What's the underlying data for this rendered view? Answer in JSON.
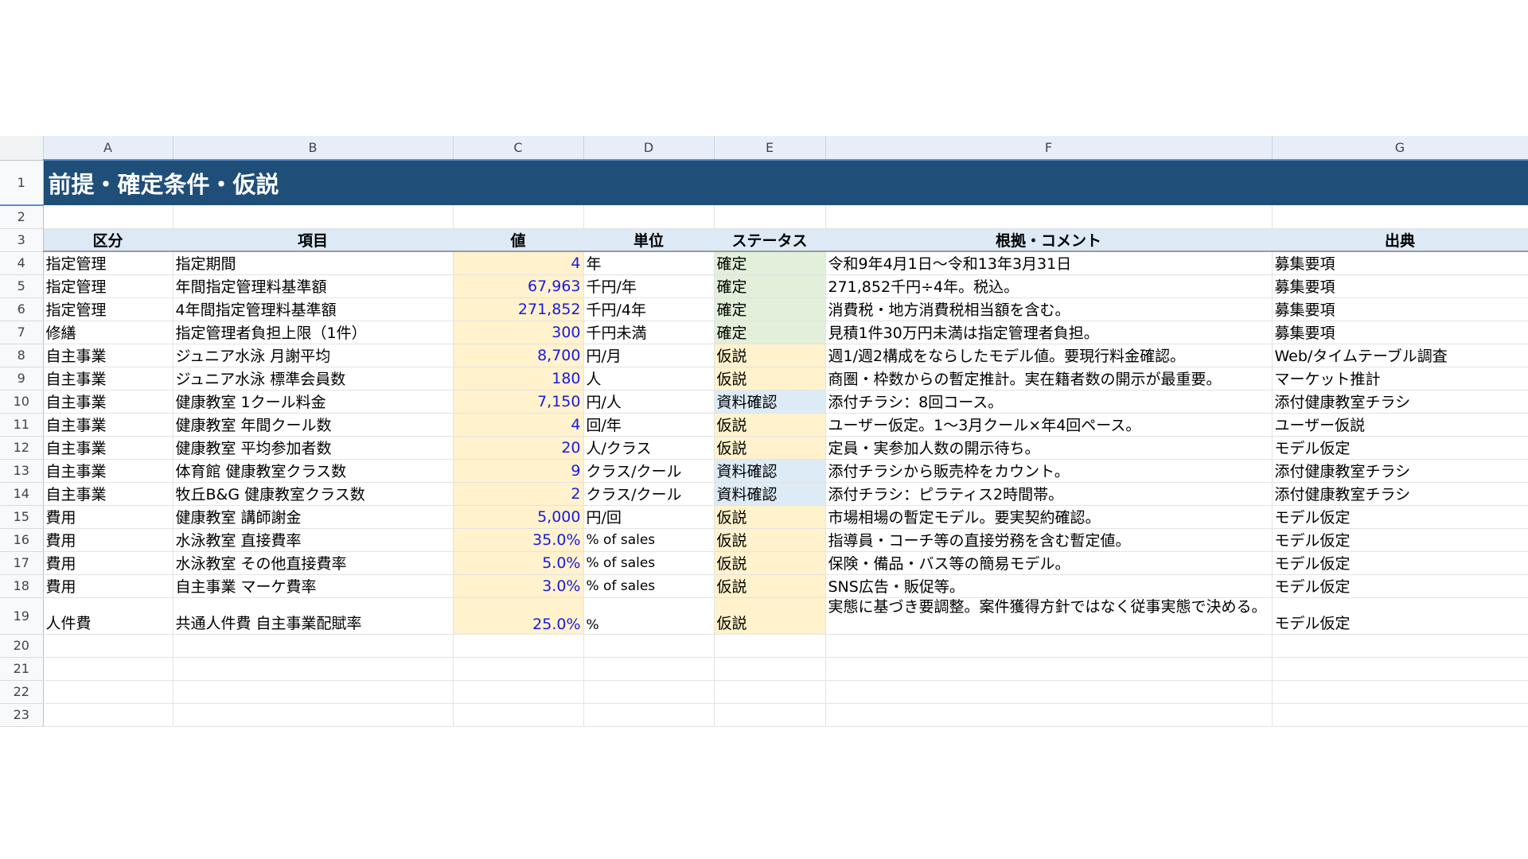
{
  "columns": [
    "A",
    "B",
    "C",
    "D",
    "E",
    "F",
    "G"
  ],
  "title": "前提・確定条件・仮説",
  "headers": [
    "区分",
    "項目",
    "値",
    "単位",
    "ステータス",
    "根拠・コメント",
    "出典"
  ],
  "rows": [
    {
      "num": "4",
      "category": "指定管理",
      "item": "指定期間",
      "value": "4",
      "unit": "年",
      "status": "確定",
      "comment": "令和9年4月1日～令和13年3月31日",
      "source": "募集要項"
    },
    {
      "num": "5",
      "category": "指定管理",
      "item": "年間指定管理料基準額",
      "value": "67,963",
      "unit": "千円/年",
      "status": "確定",
      "comment": "271,852千円÷4年。税込。",
      "source": "募集要項"
    },
    {
      "num": "6",
      "category": "指定管理",
      "item": "4年間指定管理料基準額",
      "value": "271,852",
      "unit": "千円/4年",
      "status": "確定",
      "comment": "消費税・地方消費税相当額を含む。",
      "source": "募集要項"
    },
    {
      "num": "7",
      "category": "修繕",
      "item": "指定管理者負担上限（1件）",
      "value": "300",
      "unit": "千円未満",
      "status": "確定",
      "comment": "見積1件30万円未満は指定管理者負担。",
      "source": "募集要項"
    },
    {
      "num": "8",
      "category": "自主事業",
      "item": "ジュニア水泳 月謝平均",
      "value": "8,700",
      "unit": "円/月",
      "status": "仮説",
      "comment": "週1/週2構成をならしたモデル値。要現行料金確認。",
      "source": "Web/タイムテーブル調査"
    },
    {
      "num": "9",
      "category": "自主事業",
      "item": "ジュニア水泳 標準会員数",
      "value": "180",
      "unit": "人",
      "status": "仮説",
      "comment": "商圏・枠数からの暫定推計。実在籍者数の開示が最重要。",
      "source": "マーケット推計"
    },
    {
      "num": "10",
      "category": "自主事業",
      "item": "健康教室 1クール料金",
      "value": "7,150",
      "unit": "円/人",
      "status": "資料確認",
      "comment": "添付チラシ：8回コース。",
      "source": "添付健康教室チラシ"
    },
    {
      "num": "11",
      "category": "自主事業",
      "item": "健康教室 年間クール数",
      "value": "4",
      "unit": "回/年",
      "status": "仮説",
      "comment": "ユーザー仮定。1～3月クール×年4回ペース。",
      "source": "ユーザー仮説"
    },
    {
      "num": "12",
      "category": "自主事業",
      "item": "健康教室 平均参加者数",
      "value": "20",
      "unit": "人/クラス",
      "status": "仮説",
      "comment": "定員・実参加人数の開示待ち。",
      "source": "モデル仮定"
    },
    {
      "num": "13",
      "category": "自主事業",
      "item": "体育館 健康教室クラス数",
      "value": "9",
      "unit": "クラス/クール",
      "status": "資料確認",
      "comment": "添付チラシから販売枠をカウント。",
      "source": "添付健康教室チラシ"
    },
    {
      "num": "14",
      "category": "自主事業",
      "item": "牧丘B&G 健康教室クラス数",
      "value": "2",
      "unit": "クラス/クール",
      "status": "資料確認",
      "comment": "添付チラシ：ピラティス2時間帯。",
      "source": "添付健康教室チラシ"
    },
    {
      "num": "15",
      "category": "費用",
      "item": "健康教室 講師謝金",
      "value": "5,000",
      "unit": "円/回",
      "status": "仮説",
      "comment": "市場相場の暫定モデル。要実契約確認。",
      "source": "モデル仮定"
    },
    {
      "num": "16",
      "category": "費用",
      "item": "水泳教室 直接費率",
      "value": "35.0%",
      "unit": "% of sales",
      "status": "仮説",
      "comment": "指導員・コーチ等の直接労務を含む暫定値。",
      "source": "モデル仮定"
    },
    {
      "num": "17",
      "category": "費用",
      "item": "水泳教室 その他直接費率",
      "value": "5.0%",
      "unit": "% of sales",
      "status": "仮説",
      "comment": "保険・備品・バス等の簡易モデル。",
      "source": "モデル仮定"
    },
    {
      "num": "18",
      "category": "費用",
      "item": "自主事業 マーケ費率",
      "value": "3.0%",
      "unit": "% of sales",
      "status": "仮説",
      "comment": "SNS広告・販促等。",
      "source": "モデル仮定"
    },
    {
      "num": "19",
      "category": "人件費",
      "item": "共通人件費 自主事業配賦率",
      "value": "25.0%",
      "unit": "%",
      "status": "仮説",
      "comment": "実態に基づき要調整。案件獲得方針ではなく従事実態で決める。",
      "source": "モデル仮定"
    }
  ],
  "empty_rows": [
    "2",
    "20",
    "21",
    "22",
    "23"
  ],
  "status_colors": {
    "確定": "#e2efda",
    "仮説": "#fff2cc",
    "資料確認": "#ddebf7"
  },
  "title_bg": "#1f4e79"
}
